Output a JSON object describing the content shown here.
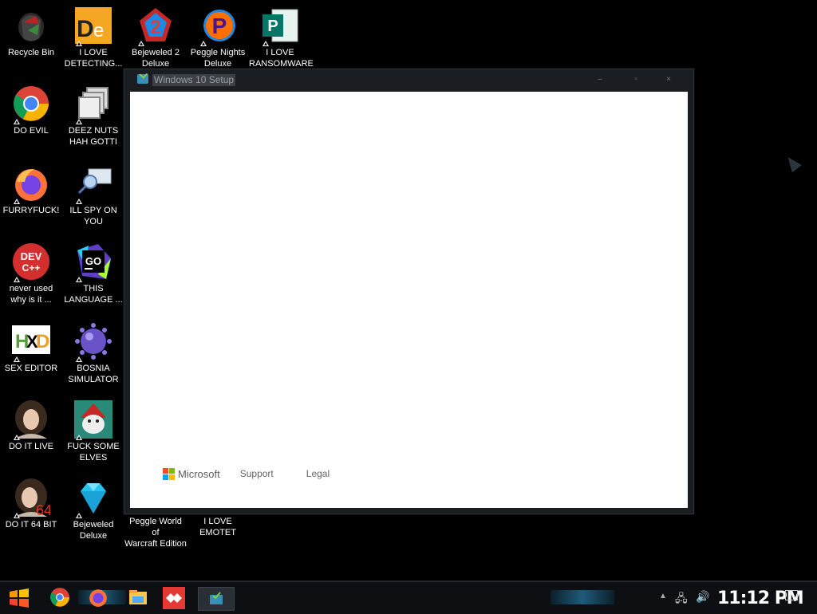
{
  "desktop_icons": [
    {
      "id": "recycle-bin",
      "label": "Recycle Bin",
      "icon": "recycle-bin-icon"
    },
    {
      "id": "i-love-detecting",
      "label": "I LOVE\nDETECTING...",
      "icon": "die-icon"
    },
    {
      "id": "bejeweled2",
      "label": "Bejeweled 2\nDeluxe",
      "icon": "bejeweled-2-icon"
    },
    {
      "id": "peggle-nights",
      "label": "Peggle Nights\nDeluxe",
      "icon": "peggle-icon"
    },
    {
      "id": "i-love-ransomware",
      "label": "I LOVE\nRANSOMWARE",
      "icon": "publisher-icon"
    },
    {
      "id": "do-evil",
      "label": "DO EVIL",
      "icon": "chrome-icon"
    },
    {
      "id": "deez-nuts",
      "label": "DEEZ NUTS\nHAH GOTTI",
      "icon": "windows-stack-icon"
    },
    {
      "id": "furryfuck",
      "label": "FURRYFUCK!",
      "icon": "firefox-icon"
    },
    {
      "id": "ill-spy",
      "label": "ILL SPY ON\nYOU",
      "icon": "network-spy-icon"
    },
    {
      "id": "never-used",
      "label": "never used\nwhy is it ...",
      "icon": "devcpp-icon"
    },
    {
      "id": "this-language",
      "label": "THIS\nLANGUAGE ...",
      "icon": "goland-icon"
    },
    {
      "id": "sex-editor",
      "label": "SEX EDITOR",
      "icon": "hxd-icon"
    },
    {
      "id": "bosnia-simulator",
      "label": "BOSNIA\nSIMULATOR",
      "icon": "spiked-ball-icon"
    },
    {
      "id": "do-it-live",
      "label": "DO IT LIVE",
      "icon": "portrait-icon"
    },
    {
      "id": "fuck-some-elves",
      "label": "FUCK SOME\nELVES",
      "icon": "wizard-icon"
    },
    {
      "id": "do-it-64",
      "label": "DO IT 64 BIT",
      "icon": "portrait-64-icon"
    },
    {
      "id": "bejeweled-deluxe",
      "label": "Bejeweled\nDeluxe",
      "icon": "diamond-icon"
    },
    {
      "id": "peggle-wow",
      "label": "Peggle World of\nWarcraft Edition",
      "icon": "peggle-wow-icon"
    },
    {
      "id": "i-love-emotet",
      "label": "I LOVE EMOTET",
      "icon": "emotet-icon"
    }
  ],
  "window": {
    "title": "Windows 10 Setup",
    "minimize": "–",
    "maximize": "▫",
    "close": "×",
    "footer": {
      "brand": "Microsoft",
      "links": [
        "Support",
        "Legal"
      ]
    }
  },
  "taskbar": {
    "clock": "11:12 PM",
    "apps": [
      "start-icon",
      "chrome-icon",
      "firefox-icon",
      "explorer-icon",
      "anydesk-icon",
      "setup-icon"
    ]
  },
  "colors": {
    "ms_red": "#f25022",
    "ms_green": "#7fba00",
    "ms_blue": "#00a4ef",
    "ms_yellow": "#ffb900"
  }
}
